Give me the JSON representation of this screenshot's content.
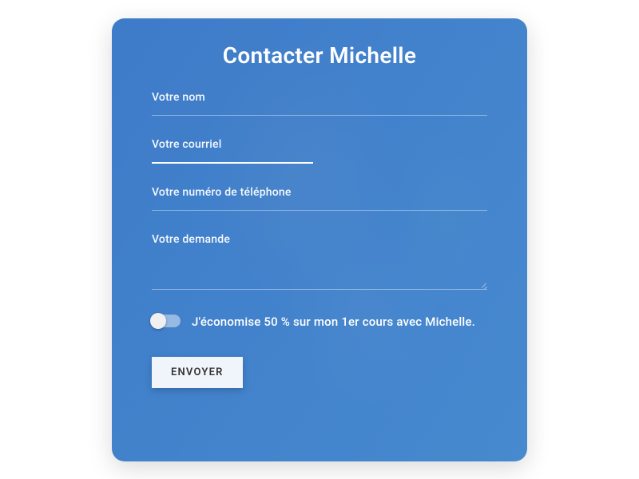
{
  "form": {
    "title": "Contacter Michelle",
    "fields": {
      "name": {
        "label": "Votre nom"
      },
      "email": {
        "label": "Votre courriel",
        "focused": true
      },
      "phone": {
        "label": "Votre numéro de téléphone"
      },
      "message": {
        "label": "Votre demande"
      }
    },
    "discount_toggle": {
      "label": "J'économise 50 % sur mon 1er cours avec Michelle.",
      "checked": false
    },
    "submit_label": "ENVOYER"
  }
}
